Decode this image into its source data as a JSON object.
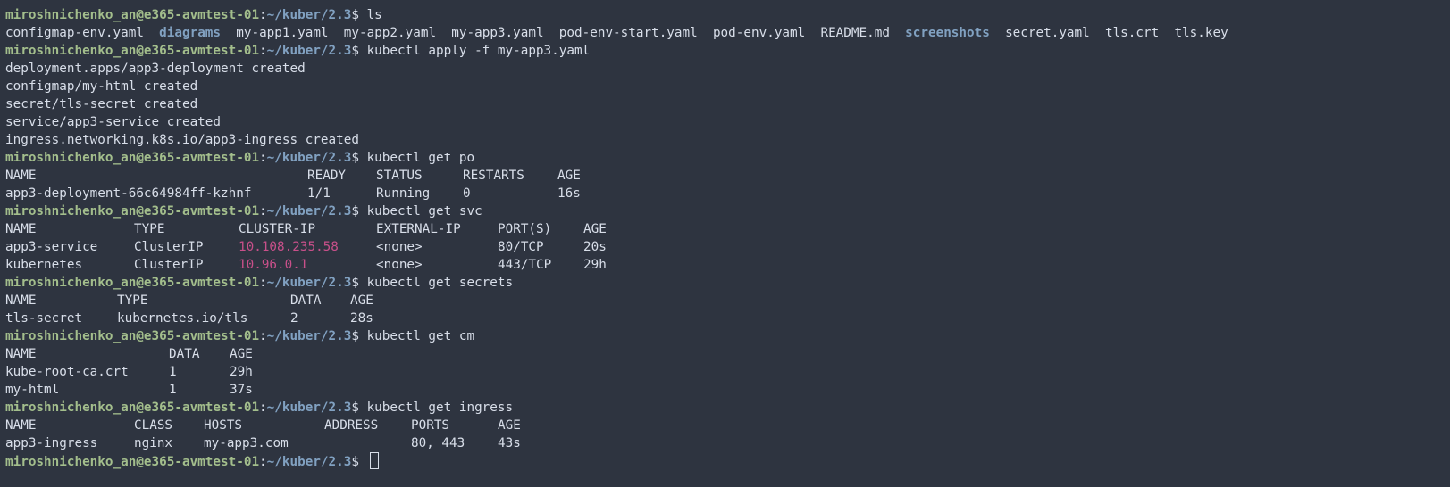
{
  "prompt": {
    "user": "miroshnichenko_an@e365-avmtest-01",
    "sep": ":",
    "path": "~/kuber/2.3",
    "sign": "$"
  },
  "commands": {
    "ls": "ls",
    "apply": "kubectl apply -f my-app3.yaml",
    "get_po": "kubectl get po",
    "get_svc": "kubectl get svc",
    "get_secrets": "kubectl get secrets",
    "get_cm": "kubectl get cm",
    "get_ingress": "kubectl get ingress"
  },
  "ls_output": [
    {
      "name": "configmap-env.yaml",
      "dir": false
    },
    {
      "name": "diagrams",
      "dir": true
    },
    {
      "name": "my-app1.yaml",
      "dir": false
    },
    {
      "name": "my-app2.yaml",
      "dir": false
    },
    {
      "name": "my-app3.yaml",
      "dir": false
    },
    {
      "name": "pod-env-start.yaml",
      "dir": false
    },
    {
      "name": "pod-env.yaml",
      "dir": false
    },
    {
      "name": "README.md",
      "dir": false
    },
    {
      "name": "screenshots",
      "dir": true
    },
    {
      "name": "secret.yaml",
      "dir": false
    },
    {
      "name": "tls.crt",
      "dir": false
    },
    {
      "name": "tls.key",
      "dir": false
    }
  ],
  "apply_output": [
    "deployment.apps/app3-deployment created",
    "configmap/my-html created",
    "secret/tls-secret created",
    "service/app3-service created",
    "ingress.networking.k8s.io/app3-ingress created"
  ],
  "pods": {
    "headers": [
      "NAME",
      "READY",
      "STATUS",
      "RESTARTS",
      "AGE"
    ],
    "rows": [
      [
        "app3-deployment-66c64984ff-kzhnf",
        "1/1",
        "Running",
        "0",
        "16s"
      ]
    ]
  },
  "services": {
    "headers": [
      "NAME",
      "TYPE",
      "CLUSTER-IP",
      "EXTERNAL-IP",
      "PORT(S)",
      "AGE"
    ],
    "rows": [
      [
        "app3-service",
        "ClusterIP",
        "10.108.235.58",
        "<none>",
        "80/TCP",
        "20s"
      ],
      [
        "kubernetes",
        "ClusterIP",
        "10.96.0.1",
        "<none>",
        "443/TCP",
        "29h"
      ]
    ]
  },
  "secrets": {
    "headers": [
      "NAME",
      "TYPE",
      "DATA",
      "AGE"
    ],
    "rows": [
      [
        "tls-secret",
        "kubernetes.io/tls",
        "2",
        "28s"
      ]
    ]
  },
  "configmaps": {
    "headers": [
      "NAME",
      "DATA",
      "AGE"
    ],
    "rows": [
      [
        "kube-root-ca.crt",
        "1",
        "29h"
      ],
      [
        "my-html",
        "1",
        "37s"
      ]
    ]
  },
  "ingresses": {
    "headers": [
      "NAME",
      "CLASS",
      "HOSTS",
      "ADDRESS",
      "PORTS",
      "AGE"
    ],
    "rows": [
      [
        "app3-ingress",
        "nginx",
        "my-app3.com",
        "",
        "80, 443",
        "43s"
      ]
    ]
  },
  "colors": {
    "background": "#2e3440",
    "foreground": "#d8dee9",
    "prompt_user": "#a3be8c",
    "prompt_path": "#81a1c1",
    "directory": "#81a1c1",
    "cluster_ip": "#c8508a"
  }
}
